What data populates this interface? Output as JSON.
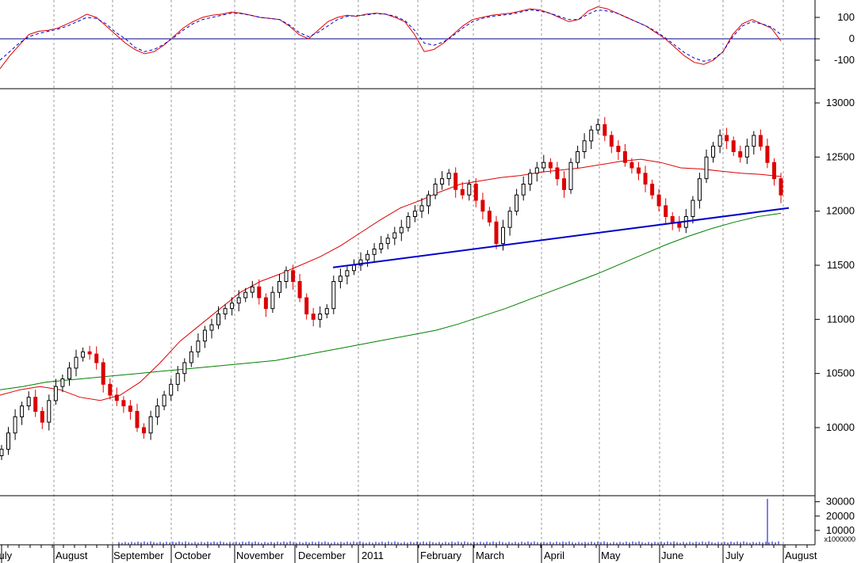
{
  "chart_data": [
    {
      "panel": "oscillator",
      "type": "line",
      "ylim": [
        -150,
        150
      ],
      "yticks": [
        "100",
        "0",
        "-100"
      ],
      "series": [
        {
          "style": "solid",
          "color": "#dd0000",
          "values": [
            -140,
            -80,
            -30,
            20,
            35,
            40,
            50,
            70,
            90,
            115,
            100,
            60,
            20,
            -20,
            -50,
            -70,
            -60,
            -30,
            10,
            50,
            80,
            100,
            110,
            115,
            125,
            120,
            110,
            100,
            95,
            90,
            60,
            20,
            0,
            40,
            80,
            100,
            110,
            105,
            115,
            120,
            115,
            100,
            80,
            20,
            -60,
            -50,
            -20,
            20,
            60,
            90,
            100,
            110,
            115,
            120,
            130,
            140,
            135,
            120,
            100,
            80,
            90,
            130,
            150,
            140,
            120,
            100,
            80,
            60,
            30,
            0,
            -40,
            -80,
            -110,
            -120,
            -100,
            -60,
            20,
            70,
            90,
            70,
            50,
            -10
          ],
          "x_range": [
            0,
            985
          ]
        },
        {
          "style": "dashed",
          "color": "#0000cc",
          "values": [
            -100,
            -60,
            -20,
            10,
            25,
            35,
            45,
            60,
            80,
            100,
            95,
            70,
            30,
            0,
            -40,
            -60,
            -50,
            -25,
            5,
            40,
            70,
            90,
            100,
            110,
            120,
            118,
            110,
            100,
            95,
            90,
            65,
            30,
            10,
            30,
            60,
            90,
            105,
            108,
            112,
            118,
            115,
            105,
            85,
            40,
            -20,
            -30,
            -15,
            15,
            50,
            80,
            95,
            105,
            110,
            115,
            125,
            135,
            130,
            120,
            105,
            90,
            90,
            115,
            135,
            130,
            120,
            100,
            80,
            60,
            35,
            5,
            -30,
            -65,
            -90,
            -105,
            -95,
            -60,
            10,
            60,
            80,
            70,
            55,
            20
          ],
          "x_range": [
            0,
            985
          ]
        }
      ]
    },
    {
      "panel": "price",
      "type": "candlestick",
      "ylim": [
        9500,
        13100
      ],
      "yticks": [
        "13000",
        "12500",
        "12000",
        "11500",
        "11000",
        "10500",
        "10000"
      ],
      "closes": [
        9800,
        9950,
        10100,
        10200,
        10280,
        10150,
        10050,
        10250,
        10380,
        10450,
        10550,
        10650,
        10700,
        10680,
        10600,
        10400,
        10300,
        10250,
        10200,
        10150,
        10000,
        9950,
        10100,
        10200,
        10300,
        10400,
        10500,
        10600,
        10700,
        10800,
        10900,
        10950,
        11050,
        11100,
        11150,
        11200,
        11250,
        11300,
        11200,
        11100,
        11250,
        11350,
        11450,
        11350,
        11200,
        11050,
        11000,
        11050,
        11100,
        11350,
        11400,
        11450,
        11500,
        11550,
        11600,
        11650,
        11700,
        11750,
        11800,
        11850,
        11950,
        12000,
        12050,
        12150,
        12250,
        12300,
        12350,
        12200,
        12150,
        12250,
        12100,
        12000,
        11900,
        11700,
        11850,
        12000,
        12150,
        12250,
        12350,
        12400,
        12450,
        12400,
        12300,
        12200,
        12450,
        12550,
        12650,
        12750,
        12800,
        12700,
        12600,
        12550,
        12450,
        12400,
        12350,
        12250,
        12150,
        12050,
        11950,
        11900,
        11850,
        11950,
        12100,
        12300,
        12500,
        12600,
        12700,
        12650,
        12550,
        12500,
        12600,
        12700,
        12600,
        12450,
        12300,
        12150
      ],
      "ma_red": [
        10300,
        10350,
        10380,
        10350,
        10280,
        10250,
        10300,
        10420,
        10600,
        10800,
        10950,
        11100,
        11250,
        11350,
        11420,
        11500,
        11580,
        11680,
        11800,
        11920,
        12030,
        12100,
        12180,
        12250,
        12280,
        12310,
        12330,
        12360,
        12380,
        12400,
        12430,
        12460,
        12480,
        12450,
        12400,
        12390,
        12370,
        12350,
        12340,
        12320
      ],
      "ma_green": [
        10350,
        10380,
        10420,
        10440,
        10460,
        10480,
        10500,
        10520,
        10540,
        10560,
        10580,
        10600,
        10620,
        10660,
        10700,
        10740,
        10780,
        10820,
        10860,
        10900,
        10960,
        11030,
        11100,
        11180,
        11260,
        11340,
        11420,
        11510,
        11600,
        11690,
        11770,
        11840,
        11900,
        11950,
        11980
      ],
      "trendline": {
        "start": 11480,
        "end": 12030
      }
    },
    {
      "panel": "volume",
      "type": "bar",
      "ylim": [
        0,
        35000
      ],
      "yticks": [
        "30000",
        "20000",
        "10000"
      ],
      "unit_label": "x1000000",
      "spike": 32000,
      "baseline": 2000
    }
  ],
  "x_axis": {
    "months": [
      "July",
      "August",
      "September",
      "October",
      "November",
      "December",
      "2011",
      "February",
      "March",
      "April",
      "May",
      "June",
      "July",
      "August"
    ]
  }
}
